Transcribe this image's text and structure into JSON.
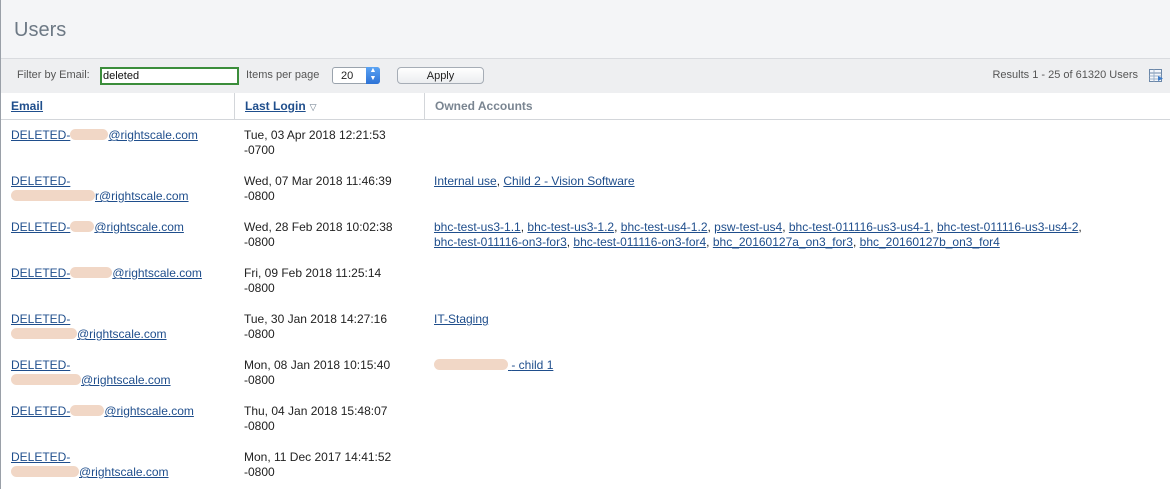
{
  "page": {
    "title": "Users"
  },
  "toolbar": {
    "filter_label": "Filter by Email:",
    "filter_value": "deleted",
    "per_page_label": "Items per page",
    "per_page_value": "20",
    "apply_label": "Apply",
    "results_text": "Results 1 - 25 of 61320 Users"
  },
  "table": {
    "headers": {
      "email": "Email",
      "last_login": "Last Login",
      "owned_accounts": "Owned Accounts"
    },
    "rows": [
      {
        "email_a": "DELETED-",
        "email_b": "@rightscale.com",
        "login1": "Tue, 03 Apr 2018 12:21:53",
        "login2": "-0700"
      },
      {
        "email_a": "DELETED-",
        "email_b": "r@rightscale.com",
        "login1": "Wed, 07 Mar 2018 11:46:39",
        "login2": "-0800",
        "accounts": [
          "Internal use",
          "Child 2 - Vision Software"
        ]
      },
      {
        "email_a": "DELETED-",
        "email_b": "@rightscale.com",
        "login1": "Wed, 28 Feb 2018 10:02:38",
        "login2": "-0800",
        "accounts": [
          "bhc-test-us3-1.1",
          "bhc-test-us3-1.2",
          "bhc-test-us4-1.2",
          "psw-test-us4",
          "bhc-test-011116-us3-us4-1",
          "bhc-test-011116-us3-us4-2",
          "bhc-test-011116-on3-for3",
          "bhc-test-011116-on3-for4",
          "bhc_20160127a_on3_for3",
          "bhc_20160127b_on3_for4"
        ]
      },
      {
        "email_a": "DELETED-",
        "email_b": "@rightscale.com",
        "login1": "Fri, 09 Feb 2018 11:25:14",
        "login2": "-0800"
      },
      {
        "email_a": "DELETED-",
        "email_b": "@rightscale.com",
        "login1": "Tue, 30 Jan 2018 14:27:16",
        "login2": "-0800",
        "accounts": [
          "IT-Staging"
        ]
      },
      {
        "email_a": "DELETED-",
        "email_b": "@rightscale.com",
        "login1": "Mon, 08 Jan 2018 10:15:40",
        "login2": "-0800",
        "account_suffix": "- child 1"
      },
      {
        "email_a": "DELETED-",
        "email_b": "@rightscale.com",
        "login1": "Thu, 04 Jan 2018 15:48:07",
        "login2": "-0800"
      },
      {
        "email_a": "DELETED-",
        "email_b": "@rightscale.com",
        "login1": "Mon, 11 Dec 2017 14:41:52",
        "login2": "-0800"
      }
    ]
  }
}
